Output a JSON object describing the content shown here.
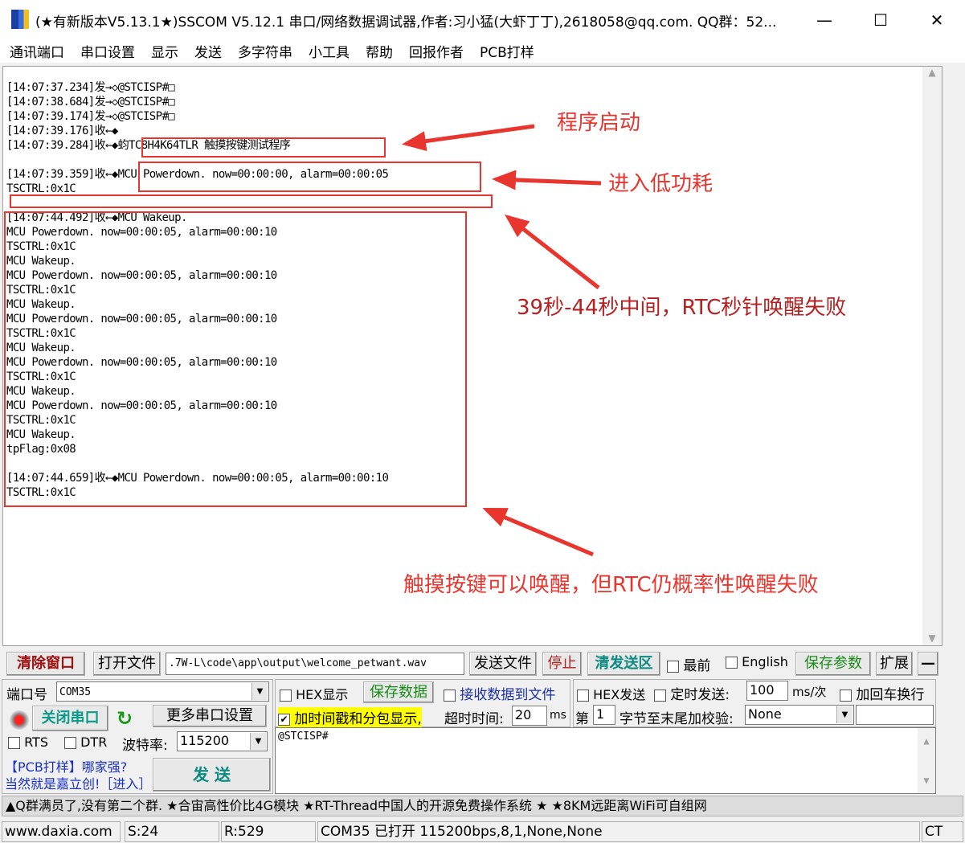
{
  "window": {
    "title": "(★有新版本V5.13.1★)SSCOM V5.12.1 串口/网络数据调试器,作者:习小猛(大虾丁丁),2618058@qq.com. QQ群：52...",
    "minimize": "—",
    "maximize": "☐",
    "close": "✕"
  },
  "menu": [
    "通讯端口",
    "串口设置",
    "显示",
    "发送",
    "多字符串",
    "小工具",
    "帮助",
    "回报作者",
    "PCB打样"
  ],
  "log": [
    "[14:07:37.234]发→◇@STCISP#□",
    "[14:07:38.684]发→◇@STCISP#□",
    "[14:07:39.174]发→◇@STCISP#□",
    "[14:07:39.176]收←◆",
    "[14:07:39.284]收←◆蚐TC8H4K64TLR 触摸按键测试程序",
    "",
    "[14:07:39.359]收←◆MCU Powerdown. now=00:00:00, alarm=00:00:05",
    "TSCTRL:0x1C",
    "",
    "[14:07:44.492]收←◆MCU Wakeup.",
    "MCU Powerdown. now=00:00:05, alarm=00:00:10",
    "TSCTRL:0x1C",
    "MCU Wakeup.",
    "MCU Powerdown. now=00:00:05, alarm=00:00:10",
    "TSCTRL:0x1C",
    "MCU Wakeup.",
    "MCU Powerdown. now=00:00:05, alarm=00:00:10",
    "TSCTRL:0x1C",
    "MCU Wakeup.",
    "MCU Powerdown. now=00:00:05, alarm=00:00:10",
    "TSCTRL:0x1C",
    "MCU Wakeup.",
    "MCU Powerdown. now=00:00:05, alarm=00:00:10",
    "TSCTRL:0x1C",
    "MCU Wakeup.",
    "tpFlag:0x08",
    "",
    "[14:07:44.659]收←◆MCU Powerdown. now=00:00:05, alarm=00:00:10",
    "TSCTRL:0x1C"
  ],
  "annotations": {
    "a1": "程序启动",
    "a2": "进入低功耗",
    "a3": "39秒-44秒中间，RTC秒针唤醒失败",
    "a4": "触摸按键可以唤醒，但RTC仍概率性唤醒失败"
  },
  "toolbar": {
    "clear": "清除窗口",
    "open_file": "打开文件",
    "file_path": ".7W-L\\code\\app\\output\\welcome_petwant.wav",
    "send_file": "发送文件",
    "stop": "停止",
    "clear_send": "清发送区",
    "topmost": "最前",
    "english": "English",
    "save_params": "保存参数",
    "expand": "扩展",
    "collapse": "—"
  },
  "port": {
    "label": "端口号",
    "value": "COM35",
    "close_port": "关闭串口",
    "more_settings": "更多串口设置",
    "rts": "RTS",
    "dtr": "DTR",
    "baud_label": "波特率:",
    "baud": "115200",
    "ad_line1": "【PCB打样】哪家强?",
    "ad_line2": "当然就是嘉立创!［进入］",
    "send": "发 送"
  },
  "recv": {
    "hex_display": "HEX显示",
    "save_data": "保存数据",
    "recv_to_file": "接收数据到文件",
    "timestamp": "加时间戳和分包显示,",
    "timeout_label": "超时时间:",
    "timeout": "20",
    "ms": "ms"
  },
  "send_opts": {
    "hex_send": "HEX发送",
    "timed_send": "定时发送:",
    "interval": "100",
    "interval_unit": "ms/次",
    "add_crlf": "加回车换行",
    "nth_label": "第",
    "nth": "1",
    "checksum_label": "字节至末尾加校验:",
    "checksum": "None"
  },
  "send_text": "@STCISP#",
  "ticker": "▲Q群满员了,没有第二个群. ★合宙高性价比4G模块 ★RT-Thread中国人的开源免费操作系统 ★ ★8KM远距离WiFi可自组网",
  "status": {
    "site": "www.daxia.com",
    "sent": "S:24",
    "recv": "R:529",
    "port_status": "COM35 已打开  115200bps,8,1,None,None",
    "ct": "CT"
  }
}
